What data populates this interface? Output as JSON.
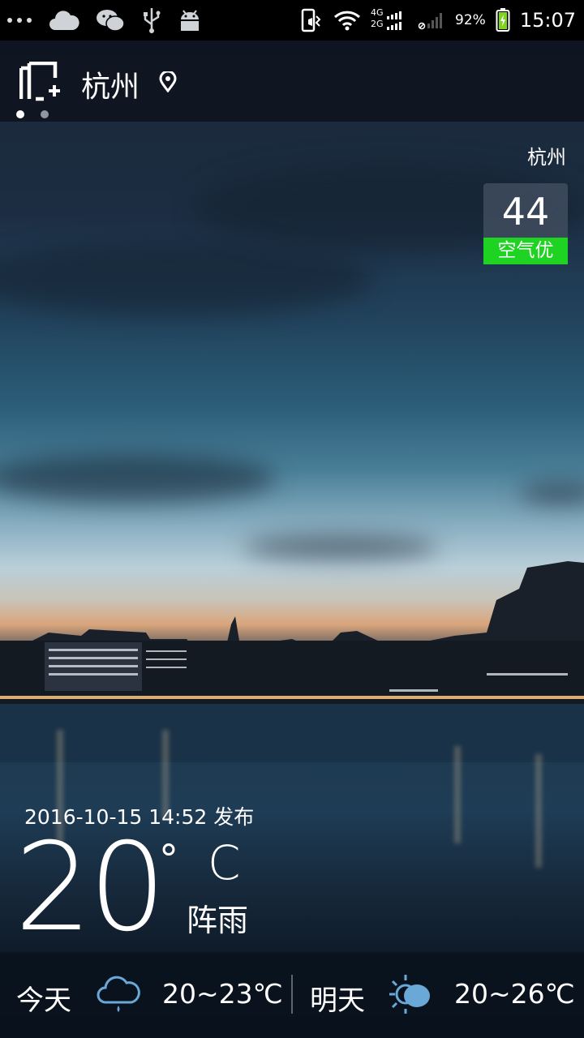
{
  "status_bar": {
    "left_icons": [
      "more-dots-icon",
      "cloud-icon",
      "wechat-icon",
      "usb-icon",
      "android-icon"
    ],
    "right_icons": [
      "vibrate-icon",
      "wifi-icon",
      "signal-4g-2g-icon",
      "signal-no-service-icon",
      "battery-charging-icon"
    ],
    "network_4g": "4G",
    "network_2g": "2G",
    "battery": "92%",
    "time": "15:07"
  },
  "header": {
    "city": "杭州",
    "manage_icon": "city-add-icon",
    "location_icon": "location-pin-icon",
    "page_count": 2,
    "active_page": 0
  },
  "aqi": {
    "city": "杭州",
    "value": "44",
    "label": "空气优",
    "label_color": "#1fd322"
  },
  "current": {
    "published": "2016-10-15 14:52 发布",
    "temperature": "20",
    "degree": "°",
    "unit": "C",
    "condition": "阵雨"
  },
  "forecast": {
    "today": {
      "label": "今天",
      "icon": "rain-cloud-icon",
      "range": "20~23℃"
    },
    "tomorrow": {
      "label": "明天",
      "icon": "sun-cloud-icon",
      "range": "20~26℃"
    }
  }
}
